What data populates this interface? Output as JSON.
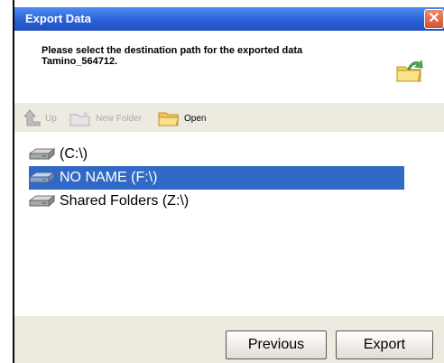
{
  "window": {
    "title": "Export Data",
    "close_glyph": "✕"
  },
  "instruction": {
    "line1": "Please select the destination path for the exported data",
    "line2": "Tamino_564712."
  },
  "toolbar": {
    "up_label": "Up",
    "new_folder_label": "New Folder",
    "open_label": "Open"
  },
  "drives": [
    {
      "label": "(C:\\)",
      "icon": "hard-drive-icon",
      "selected": false
    },
    {
      "label": "NO NAME (F:\\)",
      "icon": "hard-drive-icon",
      "selected": true
    },
    {
      "label": "Shared Folders (Z:\\)",
      "icon": "network-drive-icon",
      "selected": false
    }
  ],
  "buttons": {
    "previous": "Previous",
    "export": "Export"
  },
  "colors": {
    "titlebar": "#2a61d6",
    "selection": "#3169c6",
    "panel": "#edeae0"
  }
}
